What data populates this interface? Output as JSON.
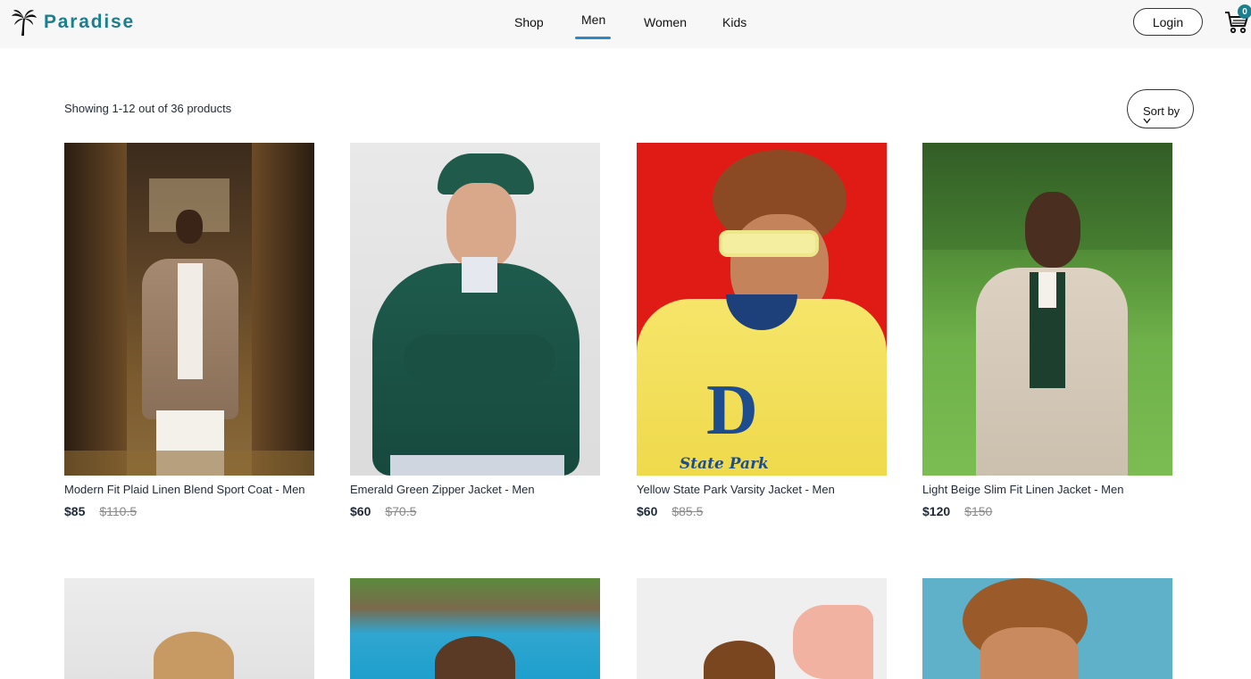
{
  "brand": {
    "name": "Paradise",
    "logo_icon": "palm-tree-icon",
    "color": "#1b7f8e"
  },
  "nav": {
    "items": [
      {
        "label": "Shop",
        "active": false
      },
      {
        "label": "Men",
        "active": true
      },
      {
        "label": "Women",
        "active": false
      },
      {
        "label": "Kids",
        "active": false
      }
    ],
    "active_color": "#2d87c9"
  },
  "header": {
    "login_label": "Login",
    "cart_icon": "shopping-cart-icon",
    "cart_count": "0"
  },
  "toolbar": {
    "result_text": "Showing 1-12 out of 36 products",
    "sort_label": "Sort by",
    "sort_icon": "chevron-down-icon"
  },
  "products": [
    {
      "name": "Modern Fit Plaid Linen Blend Sport Coat - Men",
      "price": "$85",
      "original_price": "$110.5"
    },
    {
      "name": "Emerald Green Zipper Jacket - Men",
      "price": "$60",
      "original_price": "$70.5"
    },
    {
      "name": "Yellow State Park Varsity Jacket - Men",
      "price": "$60",
      "original_price": "$85.5"
    },
    {
      "name": "Light Beige Slim Fit Linen Jacket - Men",
      "price": "$120",
      "original_price": "$150"
    }
  ],
  "jacket_letter": "D",
  "jacket_text": "State Park"
}
